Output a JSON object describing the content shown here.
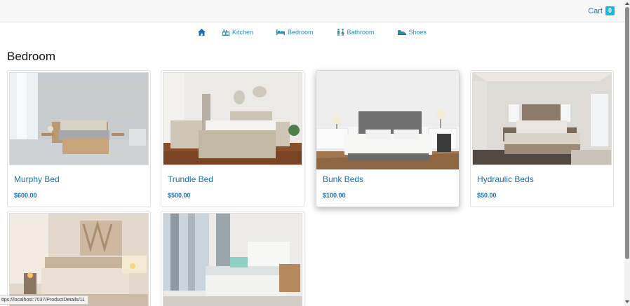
{
  "header": {
    "cart_label": "Cart",
    "cart_count": "0"
  },
  "nav": {
    "home_icon": "home-icon",
    "items": [
      {
        "label": "Kitchen",
        "icon": "kitchen-icon"
      },
      {
        "label": "Bedroom",
        "icon": "bed-icon"
      },
      {
        "label": "Bathroom",
        "icon": "bathroom-icon"
      },
      {
        "label": "Shoes",
        "icon": "shoe-icon"
      }
    ]
  },
  "page_title": "Bedroom",
  "products": [
    {
      "name": "Murphy Bed",
      "price": "$600.00"
    },
    {
      "name": "Trundle Bed",
      "price": "$500.00"
    },
    {
      "name": "Bunk Beds",
      "price": "$100.00"
    },
    {
      "name": "Hydraulic Beds",
      "price": "$50.00"
    },
    {
      "name": "",
      "price": ""
    },
    {
      "name": "",
      "price": ""
    }
  ],
  "status_bar": {
    "url": "ttps://localhost:7037/ProductDetails/11"
  },
  "colors": {
    "accent": "#1a6fae",
    "nav_text": "#2a8fa8",
    "badge": "#17b9d6"
  }
}
